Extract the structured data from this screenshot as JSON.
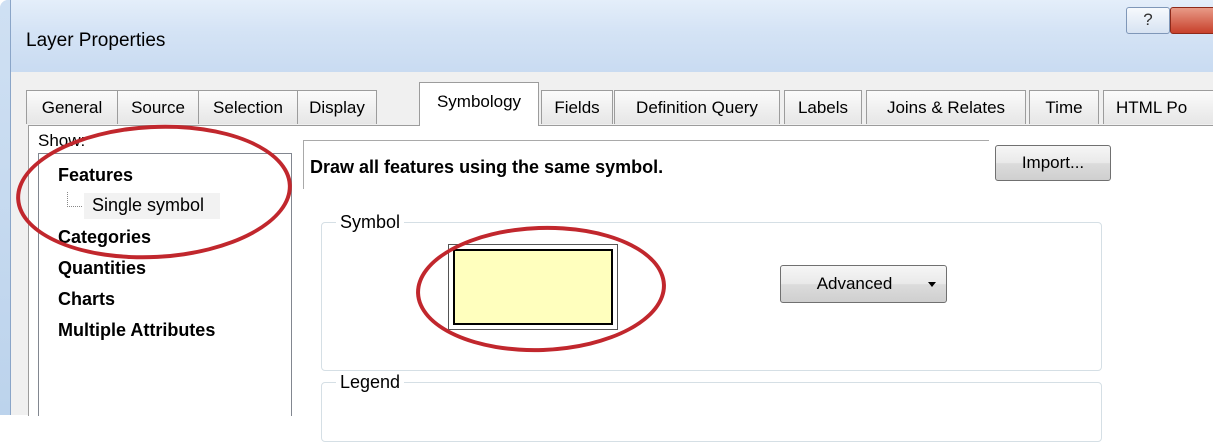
{
  "window": {
    "title": "Layer Properties",
    "help_label": "?"
  },
  "tabs": [
    {
      "label": "General",
      "active": false
    },
    {
      "label": "Source",
      "active": false
    },
    {
      "label": "Selection",
      "active": false
    },
    {
      "label": "Display",
      "active": false
    },
    {
      "label": "Symbology",
      "active": true
    },
    {
      "label": "Fields",
      "active": false
    },
    {
      "label": "Definition Query",
      "active": false
    },
    {
      "label": "Labels",
      "active": false
    },
    {
      "label": "Joins & Relates",
      "active": false
    },
    {
      "label": "Time",
      "active": false
    },
    {
      "label": "HTML Po",
      "active": false
    }
  ],
  "show": {
    "label": "Show:",
    "items": [
      {
        "label": "Features",
        "bold": true
      },
      {
        "label": "Single symbol",
        "bold": false,
        "selected": true
      },
      {
        "label": "Categories",
        "bold": true
      },
      {
        "label": "Quantities",
        "bold": true
      },
      {
        "label": "Charts",
        "bold": true
      },
      {
        "label": "Multiple Attributes",
        "bold": true
      }
    ]
  },
  "main": {
    "description": "Draw all features using the same symbol.",
    "import_label": "Import...",
    "symbol_group_label": "Symbol",
    "advanced_label": "Advanced",
    "legend_group_label": "Legend"
  },
  "colors": {
    "symbol_fill": "#ffffbe",
    "annotation": "#c1272d",
    "close_button": "#c7402b"
  }
}
